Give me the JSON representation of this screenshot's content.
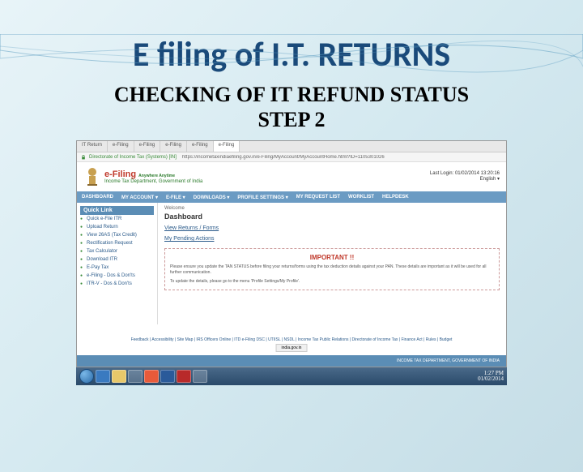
{
  "slide": {
    "title": "E filing of I.T. RETURNS",
    "subtitle_line1": "CHECKING OF IT REFUND STATUS",
    "subtitle_line2": "STEP 2"
  },
  "browser": {
    "tabs": [
      "IT Return",
      "e-Filing",
      "e-Filing",
      "e-Filing",
      "e-Filing",
      "e-Filing"
    ],
    "active_tab": "e-Filing",
    "secure_label": "Directorate of Income Tax (Systems) [IN]",
    "url": "https://incometaxindiaefiling.gov.in/e-Filing/MyAccount/MyAccountHome.html?ID=1105301026"
  },
  "header": {
    "brand": "e-Filing",
    "brand_sub": "Anywhere Anytime",
    "dept": "Income Tax Department, Government of India",
    "right1": "Last Login: 01/02/2014 13:20:16",
    "right2": "English ▾"
  },
  "nav": [
    "DASHBOARD",
    "MY ACCOUNT ▾",
    "E-FILE ▾",
    "DOWNLOADS ▾",
    "PROFILE SETTINGS ▾",
    "MY REQUEST LIST",
    "WORKLIST",
    "HELPDESK"
  ],
  "sidebar": {
    "title": "Quick Link",
    "items": [
      "Quick e-File ITR",
      "Upload Return",
      "View 26AS (Tax Credit)",
      "Rectification Request",
      "Tax Calculator",
      "Download ITR",
      "E-Pay Tax",
      "e-Filing - Dos & Don'ts",
      "ITR-V - Dos & Don'ts"
    ]
  },
  "main": {
    "welcome": "Welcome",
    "dashboard": "Dashboard",
    "link1": "View Returns / Forms",
    "link2": "My Pending Actions",
    "important_title": "IMPORTANT !!",
    "important_body1": "Please ensure you update the TAN STATUS before filing your returns/forms using the tax deduction details against your PAN. These details are important as it will be used for all further communication.",
    "important_body2": "To update the details, please go to the menu 'Profile Settings/My Profile'."
  },
  "footer": {
    "links": "Feedback | Accessibility | Site Map | IRS Officers Online | ITD e-Filing DSC | UTIISL | NSDL | Income Tax Public Relations | Directorate of Income Tax | Finance Act | Rules | Budget",
    "badge": "india.gov.in",
    "copyright": "INCOME TAX DEPARTMENT, GOVERNMENT OF INDIA"
  },
  "taskbar": {
    "time": "1:27 PM",
    "date": "01/02/2014"
  }
}
